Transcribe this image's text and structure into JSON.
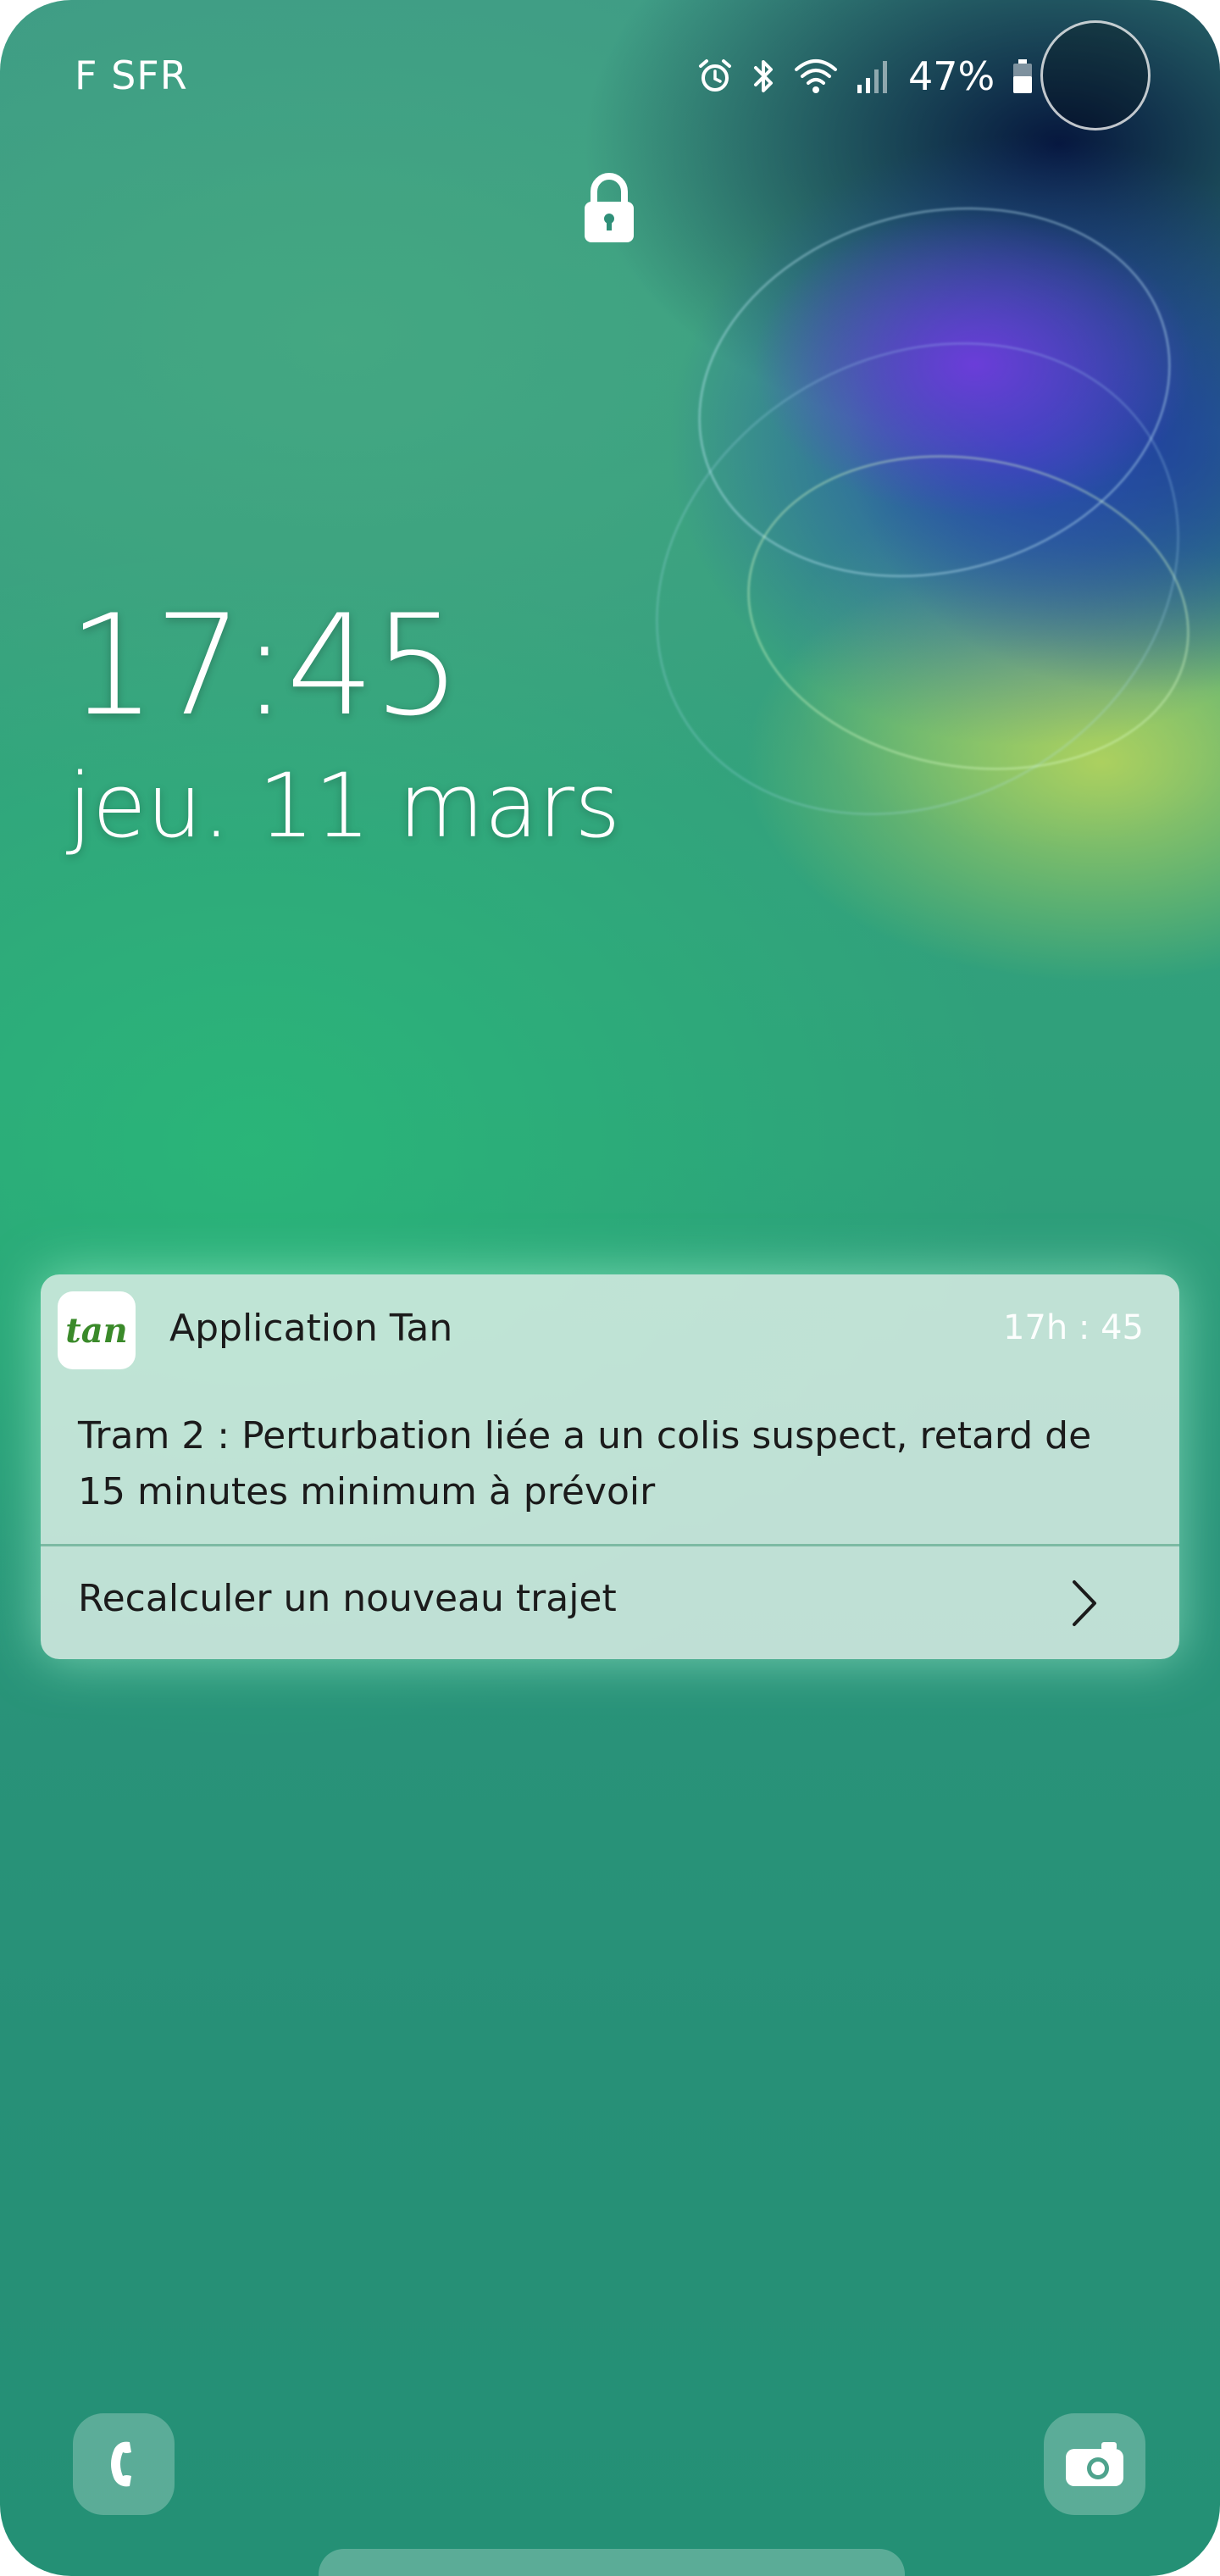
{
  "status_bar": {
    "carrier": "F SFR",
    "battery_percent": "47%",
    "icons": [
      "alarm-icon",
      "bluetooth-icon",
      "wifi-icon",
      "signal-icon",
      "battery-icon"
    ]
  },
  "lock_screen": {
    "time": "17:45",
    "date": "jeu. 11 mars"
  },
  "notification": {
    "app_icon_text": "tan",
    "app_name": "Application Tan",
    "time": "17h : 45",
    "body": "Tram 2 : Perturbation liée a un colis suspect, retard de 15 minutes minimum à prévoir",
    "action_label": "Recalculer un nouveau trajet"
  },
  "shortcuts": {
    "left": "phone-icon",
    "right": "camera-icon"
  },
  "colors": {
    "notification_bg": "#e1f0e9",
    "wallpaper_green": "#2ea07a",
    "app_logo_green": "#3a8a2a"
  }
}
